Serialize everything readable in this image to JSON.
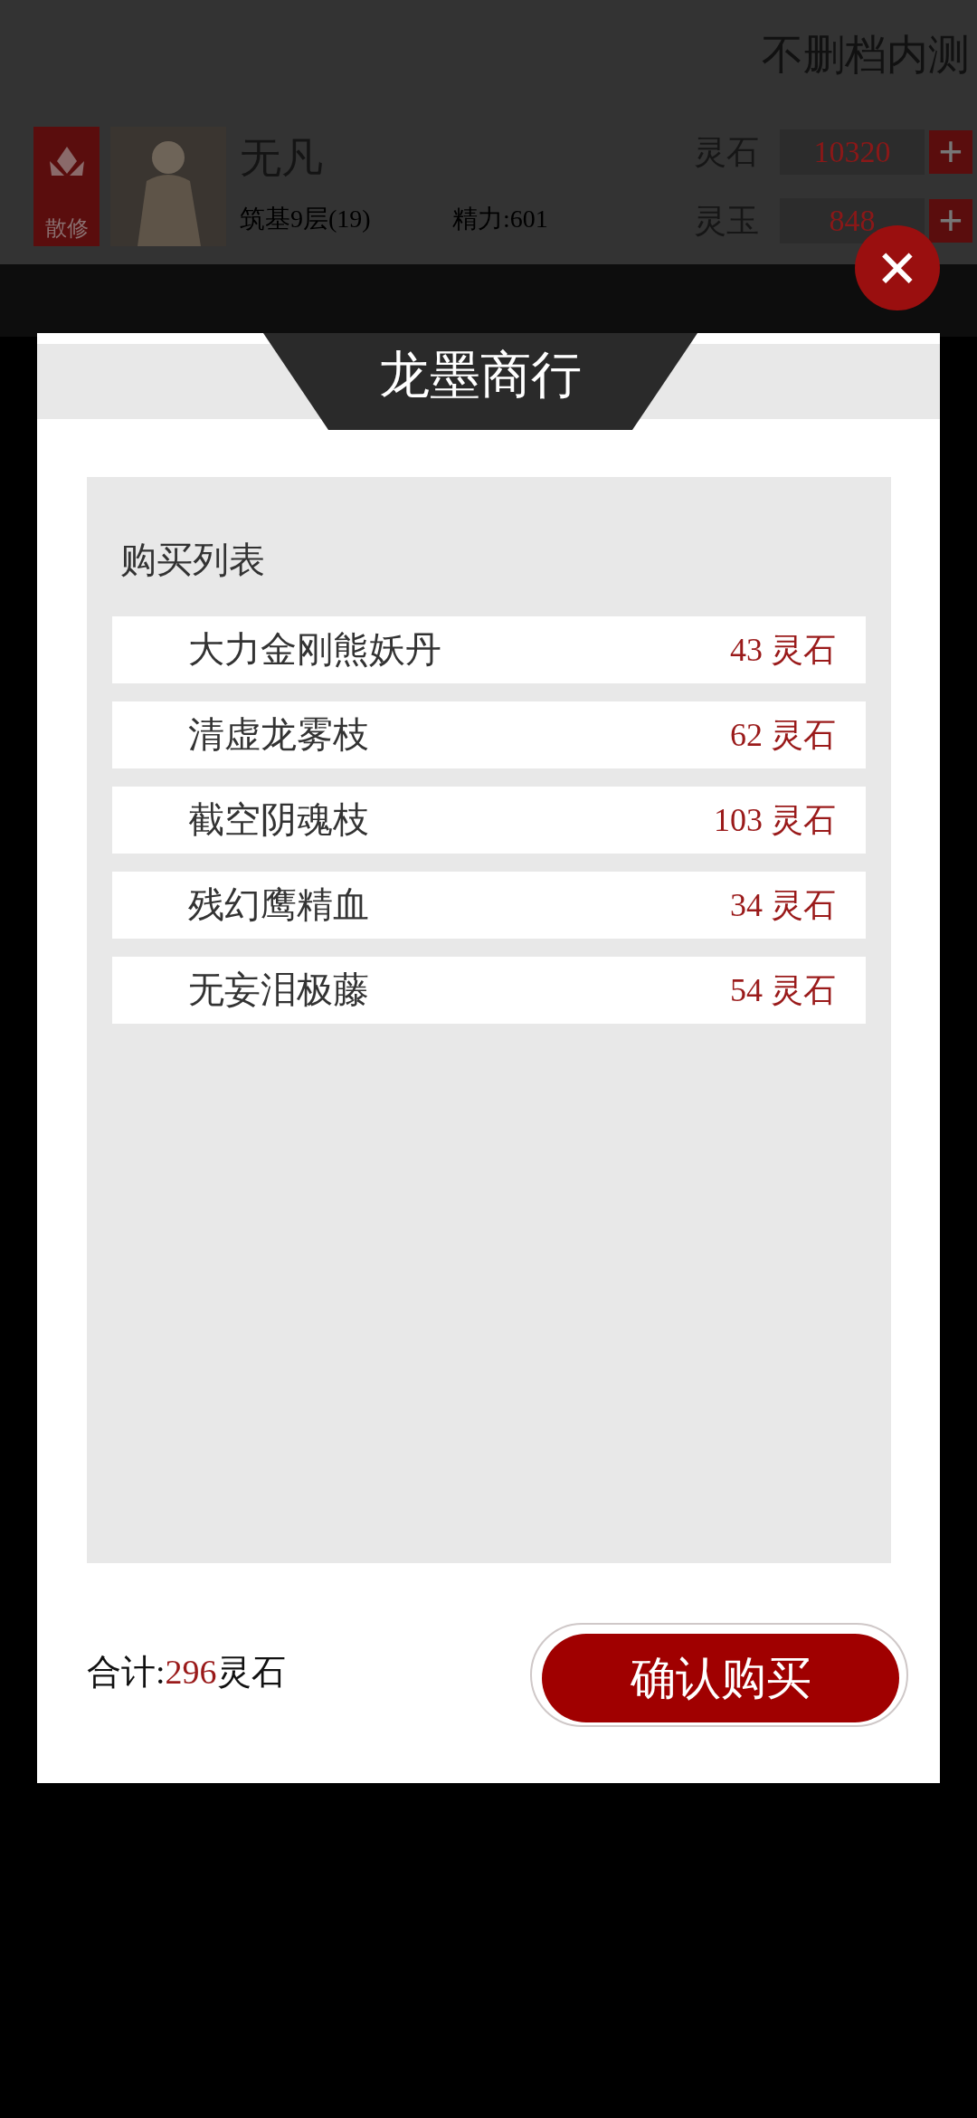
{
  "header": {
    "badge": "不删档内测",
    "player": {
      "faction": "散修",
      "name": "无凡",
      "realm": "筑基9层(19)",
      "energy": "精力:601"
    },
    "currencies": [
      {
        "label": "灵石",
        "value": "10320",
        "plus": "+"
      },
      {
        "label": "灵玉",
        "value": "848",
        "plus": "+"
      }
    ]
  },
  "dialog": {
    "title": "龙墨商行",
    "close": "×",
    "list_title": "购买列表",
    "items": [
      {
        "name": "大力金刚熊妖丹",
        "price": "43 灵石"
      },
      {
        "name": "清虚龙雾枝",
        "price": "62 灵石"
      },
      {
        "name": "截空阴魂枝",
        "price": "103 灵石"
      },
      {
        "name": "残幻鹰精血",
        "price": "34 灵石"
      },
      {
        "name": "无妄泪极藤",
        "price": "54 灵石"
      }
    ],
    "total": {
      "label": "合计:",
      "amount": "296",
      "unit": "灵石"
    },
    "confirm": "确认购买"
  }
}
